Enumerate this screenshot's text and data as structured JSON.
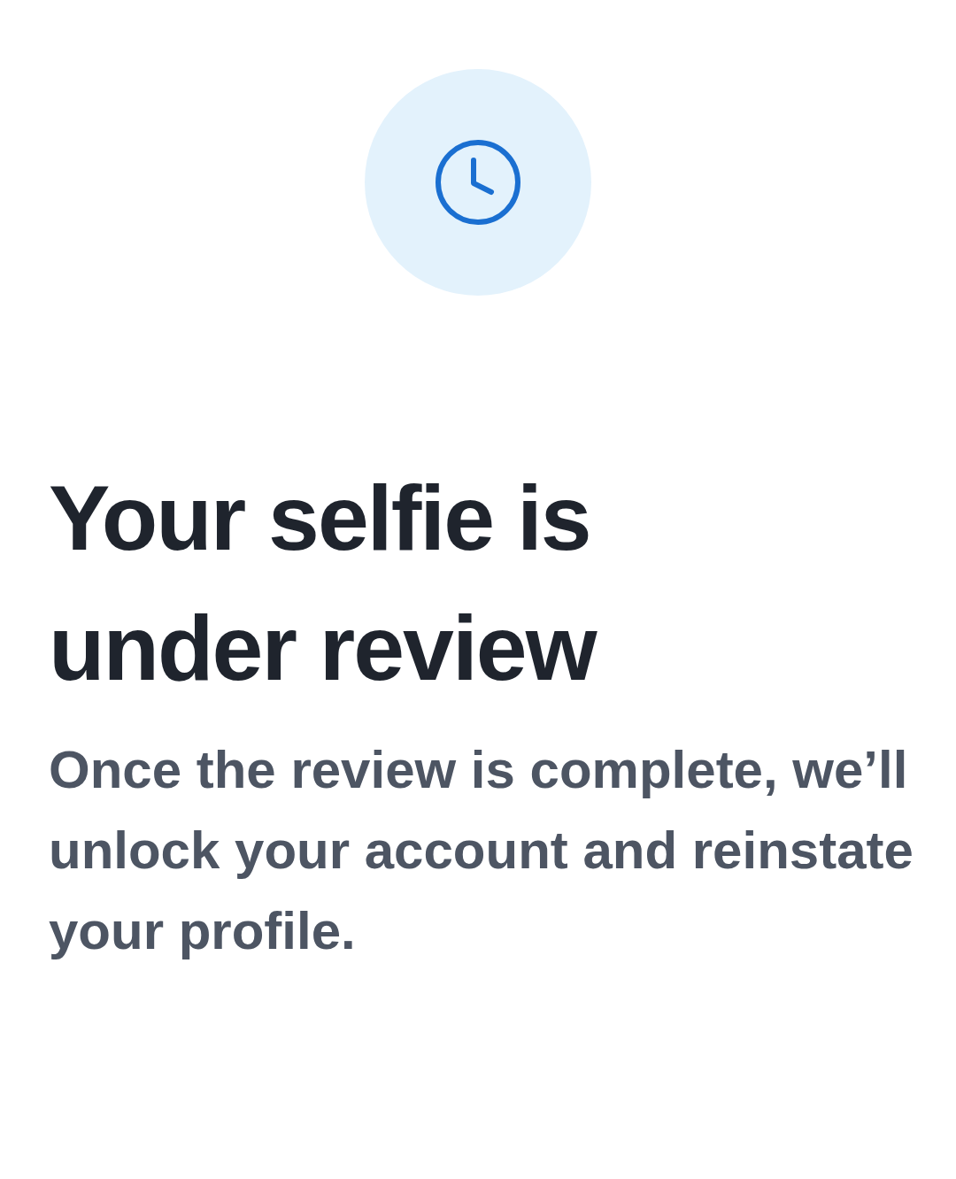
{
  "status": {
    "kind": "pending"
  },
  "title": "Your selfie is under review",
  "message": "Once the review is complete, we’ll unlock your account and reinstate your profile."
}
